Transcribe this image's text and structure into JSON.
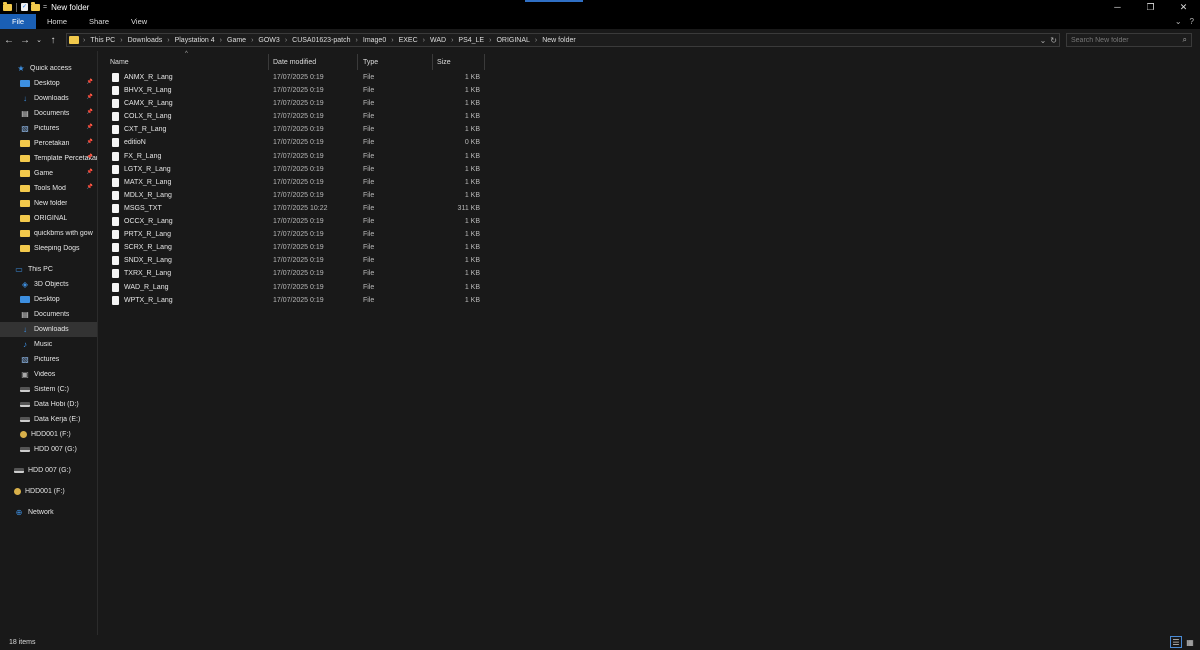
{
  "window": {
    "title": "New folder",
    "quick_access_toolbar": {
      "dropdown": "="
    },
    "controls": {
      "minimize": "─",
      "maximize": "❐",
      "close": "✕"
    }
  },
  "ribbon": {
    "tabs": [
      "File",
      "Home",
      "Share",
      "View"
    ],
    "right": {
      "collapse": "⌄",
      "help": "?"
    }
  },
  "nav": {
    "back": "←",
    "forward": "→",
    "recent": "⌄",
    "up": "↑"
  },
  "address": {
    "crumbs": [
      "This PC",
      "Downloads",
      "Playstation 4",
      "Game",
      "GOW3",
      "CUSA01623-patch",
      "Image0",
      "EXEC",
      "WAD",
      "PS4_LE",
      "ORIGINAL",
      "New folder"
    ],
    "separator": "›",
    "dropdown": "⌄",
    "refresh": "↻"
  },
  "search": {
    "placeholder": "Search New folder",
    "icon": "⌕"
  },
  "sidebar": {
    "quick_access": {
      "label": "Quick access",
      "items": [
        {
          "label": "Desktop",
          "icon": "desktop-icon",
          "pinned": true
        },
        {
          "label": "Downloads",
          "icon": "download-icon",
          "pinned": true
        },
        {
          "label": "Documents",
          "icon": "document-icon",
          "pinned": true
        },
        {
          "label": "Pictures",
          "icon": "pictures-icon",
          "pinned": true
        },
        {
          "label": "Percetakan",
          "icon": "folder-icon",
          "pinned": true
        },
        {
          "label": "Template Percetakan",
          "icon": "folder-icon",
          "pinned": true
        },
        {
          "label": "Game",
          "icon": "folder-icon",
          "pinned": true
        },
        {
          "label": "Tools Mod",
          "icon": "folder-icon",
          "pinned": true
        },
        {
          "label": "New folder",
          "icon": "folder-icon",
          "pinned": false
        },
        {
          "label": "ORIGINAL",
          "icon": "folder-icon",
          "pinned": false
        },
        {
          "label": "quickbms with gow",
          "icon": "folder-icon",
          "pinned": false
        },
        {
          "label": "Sleeping Dogs",
          "icon": "folder-icon",
          "pinned": false
        }
      ]
    },
    "this_pc": {
      "label": "This PC",
      "items": [
        {
          "label": "3D Objects",
          "icon": "3d-objects-icon"
        },
        {
          "label": "Desktop",
          "icon": "desktop-icon"
        },
        {
          "label": "Documents",
          "icon": "document-icon"
        },
        {
          "label": "Downloads",
          "icon": "download-icon",
          "selected": true
        },
        {
          "label": "Music",
          "icon": "music-icon"
        },
        {
          "label": "Pictures",
          "icon": "pictures-icon"
        },
        {
          "label": "Videos",
          "icon": "videos-icon"
        },
        {
          "label": "Sistem (C:)",
          "icon": "drive-icon"
        },
        {
          "label": "Data Hobi (D:)",
          "icon": "drive-icon"
        },
        {
          "label": "Data Kerja (E:)",
          "icon": "drive-icon"
        },
        {
          "label": "HDD001 (F:)",
          "icon": "disc-icon"
        },
        {
          "label": "HDD 007 (G:)",
          "icon": "drive-icon"
        }
      ]
    },
    "roots": [
      {
        "label": "HDD 007 (G:)",
        "icon": "drive-icon"
      },
      {
        "label": "HDD001 (F:)",
        "icon": "disc-icon"
      },
      {
        "label": "Network",
        "icon": "network-icon"
      }
    ]
  },
  "columns": {
    "name": "Name",
    "date": "Date modified",
    "type": "Type",
    "size": "Size",
    "sort_indicator": "^"
  },
  "files": [
    {
      "name": "ANMX_R_Lang",
      "date": "17/07/2025 0:19",
      "type": "File",
      "size": "1 KB"
    },
    {
      "name": "BHVX_R_Lang",
      "date": "17/07/2025 0:19",
      "type": "File",
      "size": "1 KB"
    },
    {
      "name": "CAMX_R_Lang",
      "date": "17/07/2025 0:19",
      "type": "File",
      "size": "1 KB"
    },
    {
      "name": "COLX_R_Lang",
      "date": "17/07/2025 0:19",
      "type": "File",
      "size": "1 KB"
    },
    {
      "name": "CXT_R_Lang",
      "date": "17/07/2025 0:19",
      "type": "File",
      "size": "1 KB"
    },
    {
      "name": "editioN",
      "date": "17/07/2025 0:19",
      "type": "File",
      "size": "0 KB"
    },
    {
      "name": "FX_R_Lang",
      "date": "17/07/2025 0:19",
      "type": "File",
      "size": "1 KB"
    },
    {
      "name": "LGTX_R_Lang",
      "date": "17/07/2025 0:19",
      "type": "File",
      "size": "1 KB"
    },
    {
      "name": "MATX_R_Lang",
      "date": "17/07/2025 0:19",
      "type": "File",
      "size": "1 KB"
    },
    {
      "name": "MDLX_R_Lang",
      "date": "17/07/2025 0:19",
      "type": "File",
      "size": "1 KB"
    },
    {
      "name": "MSGS_TXT",
      "date": "17/07/2025 10:22",
      "type": "File",
      "size": "311 KB"
    },
    {
      "name": "OCCX_R_Lang",
      "date": "17/07/2025 0:19",
      "type": "File",
      "size": "1 KB"
    },
    {
      "name": "PRTX_R_Lang",
      "date": "17/07/2025 0:19",
      "type": "File",
      "size": "1 KB"
    },
    {
      "name": "SCRX_R_Lang",
      "date": "17/07/2025 0:19",
      "type": "File",
      "size": "1 KB"
    },
    {
      "name": "SNDX_R_Lang",
      "date": "17/07/2025 0:19",
      "type": "File",
      "size": "1 KB"
    },
    {
      "name": "TXRX_R_Lang",
      "date": "17/07/2025 0:19",
      "type": "File",
      "size": "1 KB"
    },
    {
      "name": "WAD_R_Lang",
      "date": "17/07/2025 0:19",
      "type": "File",
      "size": "1 KB"
    },
    {
      "name": "WPTX_R_Lang",
      "date": "17/07/2025 0:19",
      "type": "File",
      "size": "1 KB"
    }
  ],
  "status": {
    "item_count": "18 items",
    "details_view": "☰",
    "icons_view": "▦"
  }
}
